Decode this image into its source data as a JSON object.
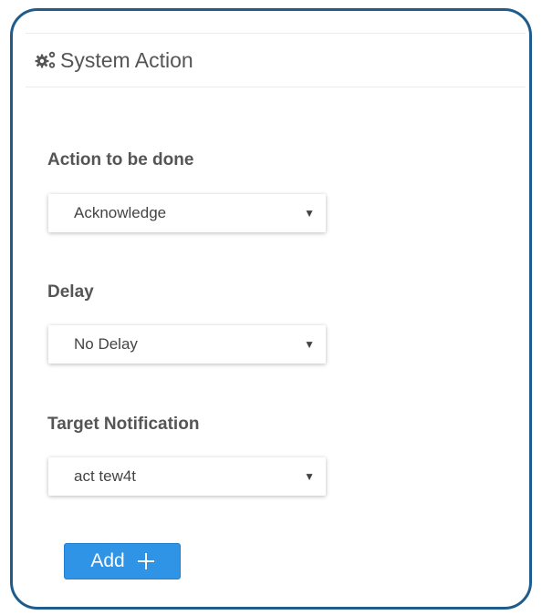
{
  "panel": {
    "title": "System Action",
    "icon": "gears-icon"
  },
  "fields": [
    {
      "label": "Action to be done",
      "value": "Acknowledge"
    },
    {
      "label": "Delay",
      "value": "No Delay"
    },
    {
      "label": "Target Notification",
      "value": "act tew4t"
    }
  ],
  "add_button": {
    "label": "Add",
    "icon": "plus-icon"
  },
  "colors": {
    "frame_border": "#1f5c8c",
    "button_bg": "#2f93e6",
    "text": "#555555"
  }
}
